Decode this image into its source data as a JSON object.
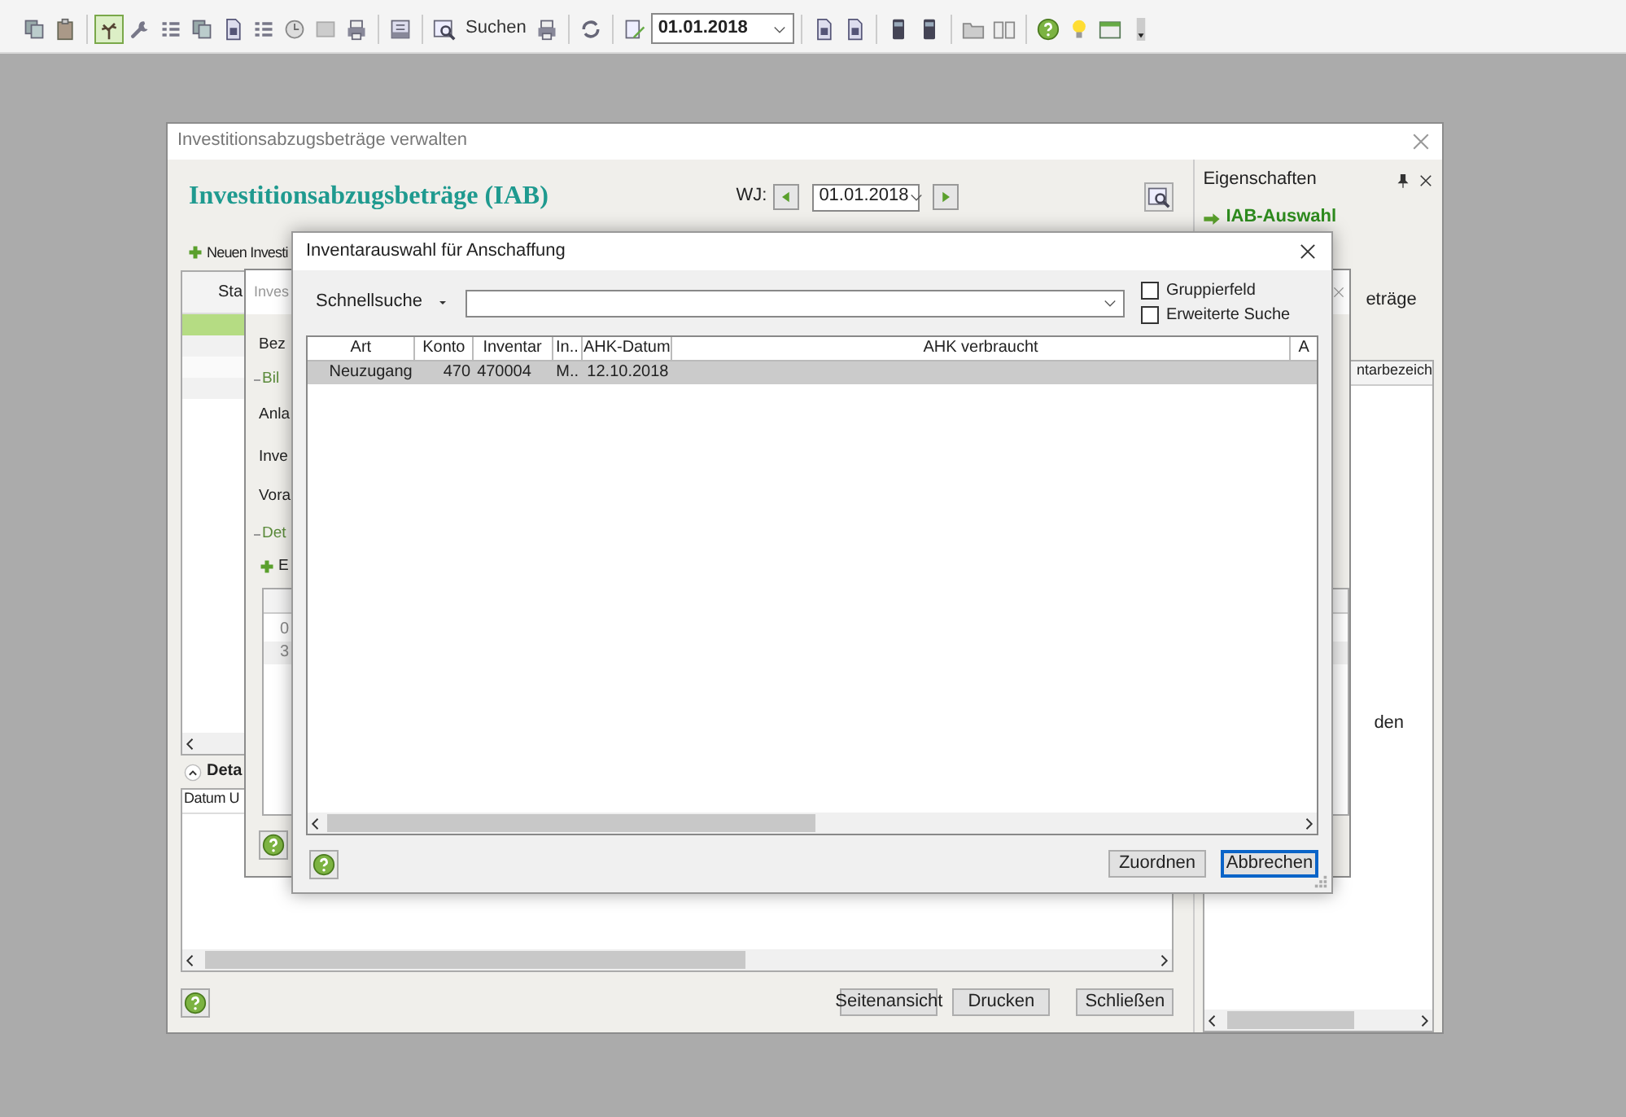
{
  "toolbar": {
    "items": [
      {
        "kind": "copy",
        "selected": false
      },
      {
        "kind": "paste",
        "selected": false
      },
      {
        "kind": "separator"
      },
      {
        "kind": "tree",
        "selected": true
      },
      {
        "kind": "wrench",
        "selected": false
      },
      {
        "kind": "list",
        "selected": false
      },
      {
        "kind": "copy",
        "selected": false
      },
      {
        "kind": "document",
        "selected": false
      },
      {
        "kind": "list",
        "selected": false
      },
      {
        "kind": "clock",
        "selected": false
      },
      {
        "kind": "box",
        "selected": false
      },
      {
        "kind": "printer",
        "selected": false
      },
      {
        "kind": "separator"
      },
      {
        "kind": "tray",
        "selected": false
      },
      {
        "kind": "separator"
      },
      {
        "kind": "search",
        "selected": false
      },
      {
        "kind": "text",
        "label": "Suchen",
        "selected": false
      },
      {
        "kind": "printer",
        "selected": false
      },
      {
        "kind": "separator"
      },
      {
        "kind": "refresh",
        "selected": false
      },
      {
        "kind": "separator"
      },
      {
        "kind": "edit",
        "selected": false
      },
      {
        "kind": "date",
        "value": "01.01.2018"
      },
      {
        "kind": "separator"
      },
      {
        "kind": "document",
        "selected": false
      },
      {
        "kind": "document",
        "selected": false
      },
      {
        "kind": "separator"
      },
      {
        "kind": "calculator",
        "selected": false
      },
      {
        "kind": "calculator",
        "selected": false
      },
      {
        "kind": "separator"
      },
      {
        "kind": "folder",
        "selected": false
      },
      {
        "kind": "book",
        "selected": false
      },
      {
        "kind": "separator"
      },
      {
        "kind": "help",
        "selected": false
      },
      {
        "kind": "bulb",
        "selected": false
      },
      {
        "kind": "lex",
        "selected": false
      },
      {
        "kind": "overflow",
        "selected": false
      }
    ]
  },
  "main_window": {
    "title": "Investitionsabzugsbeträge verwalten",
    "heading": "Investitionsabzugsbeträge (IAB)",
    "fiscal_year": {
      "label": "WJ:",
      "value": "01.01.2018"
    },
    "new_button": "Neuen Investi",
    "table": {
      "columns": [
        "Sta"
      ],
      "rows": [
        {
          "selected": true
        },
        {
          "selected": false
        },
        {
          "selected": false
        },
        {
          "selected": false
        }
      ]
    },
    "details": {
      "title": "Deta",
      "columns": [
        "Datum U"
      ]
    },
    "buttons": [
      "Seitenansicht",
      "Drucken",
      "Schließen"
    ]
  },
  "properties_panel": {
    "title": "Eigenschaften",
    "items": [
      {
        "label": "IAB-Auswahl",
        "selected": true
      }
    ],
    "text_fragment": "eträge",
    "table": {
      "columns": [
        "ntarbezeich"
      ],
      "text_fragment": "den"
    }
  },
  "edit_window": {
    "title": "Inves",
    "labels": [
      {
        "kind": "field",
        "text": "Bez"
      },
      {
        "kind": "group",
        "text": "Bil"
      },
      {
        "kind": "field",
        "text": "Anla"
      },
      {
        "kind": "field",
        "text": "Inve"
      },
      {
        "kind": "field",
        "text": "Vora"
      },
      {
        "kind": "group",
        "text": "Det"
      },
      {
        "kind": "add",
        "text": "E"
      }
    ],
    "grid": {
      "rows": [
        "0",
        "3"
      ]
    }
  },
  "dialog": {
    "title": "Inventarauswahl für Anschaffung",
    "quick_search": {
      "label": "Schnellsuche"
    },
    "options": [
      {
        "label": "Gruppierfeld",
        "checked": false
      },
      {
        "label": "Erweiterte Suche",
        "checked": false
      }
    ],
    "grid": {
      "columns": [
        "Art",
        "Konto",
        "Inventar",
        "In..",
        "AHK-Datum",
        "AHK verbraucht",
        "A"
      ],
      "rows": [
        {
          "cells": [
            "Neuzugang",
            "470",
            "470004",
            "M..",
            "12.10.2018"
          ],
          "selected": true
        }
      ]
    },
    "buttons": [
      {
        "label": "Zuordnen",
        "default": false
      },
      {
        "label": "Abbrechen",
        "default": true
      }
    ]
  }
}
